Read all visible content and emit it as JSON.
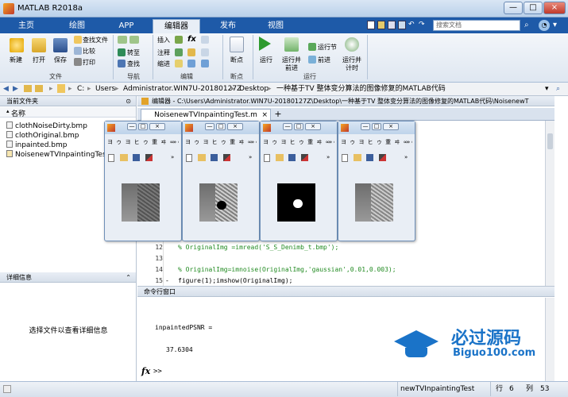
{
  "app": {
    "title": "MATLAB R2018a"
  },
  "window_controls": [
    "—",
    "□",
    "×"
  ],
  "tabs": [
    {
      "label": "主页"
    },
    {
      "label": "绘图"
    },
    {
      "label": "APP"
    },
    {
      "label": "编辑器"
    },
    {
      "label": "发布"
    },
    {
      "label": "视图"
    }
  ],
  "search": {
    "placeholder": "搜索文档"
  },
  "ribbon": {
    "file": {
      "new": "新建",
      "open": "打开",
      "save": "保存",
      "find_files": "查找文件",
      "compare": "比较",
      "print": "打印",
      "group": "文件"
    },
    "nav": {
      "goto": "转至",
      "find": "查找",
      "group": "导航"
    },
    "edit": {
      "insert": "插入",
      "comment": "注释",
      "indent": "缩进",
      "fx": "fx",
      "group": "编辑"
    },
    "breakpoints": {
      "label": "断点",
      "group": "断点"
    },
    "run": {
      "run": "运行",
      "run_advance_1": "运行并",
      "run_advance_2": "前进",
      "run_section": "运行节",
      "advance": "前进",
      "run_time_1": "运行并",
      "run_time_2": "计时",
      "group": "运行"
    }
  },
  "path": [
    "C:",
    "Users",
    "Administrator.WIN7U-20180127Z",
    "Desktop",
    "一种基于TV 整体变分算法的图像修复的MATLAB代码"
  ],
  "current_folder": {
    "header": "当前文件夹",
    "column": "名称",
    "files": [
      "clothNoiseDirty.bmp",
      "clothOriginal.bmp",
      "inpainted.bmp",
      "NoisenewTVInpaintingTest"
    ]
  },
  "details": {
    "header": "详细信息",
    "hint": "选择文件以查看详细信息"
  },
  "editor": {
    "header": "编辑器 - C:\\Users\\Administrator.WIN7U-20180127Z\\Desktop\\一种基于TV 整体变分算法的图像修复的MATLAB代码\\NoisenewT",
    "tab": "NoisenewTVInpaintingTest.m",
    "add_tab": "+",
    "lines": [
      {
        "num": "12",
        "marker": "",
        "text": "% OriginalImg =imread('S_S_Denimb_t.bmp');",
        "comment": true
      },
      {
        "num": "13",
        "marker": "",
        "text": "",
        "comment": false
      },
      {
        "num": "14",
        "marker": "",
        "text": "% OriginalImg=imnoise(OriginalImg,'gaussian',0.01,0.003);",
        "comment": true
      },
      {
        "num": "15",
        "marker": "-",
        "text": "figure(1);imshow(OriginalImg);",
        "comment": false
      }
    ]
  },
  "command_window": {
    "header": "命令行窗口",
    "output": [
      "inpaintedPSNR =",
      "37.6304"
    ],
    "prompt_fx": "fx",
    "prompt": ">>"
  },
  "figures": [
    {
      "image": "cloth-noisy"
    },
    {
      "image": "cloth-noisy-blob"
    },
    {
      "image": "mask"
    },
    {
      "image": "cloth-inpainted"
    }
  ],
  "figure_toolbar": {
    "row1": "ヨ ゥ ヨ ヒ ゥ 重 ヰ ∞ ∞",
    "more": "»"
  },
  "status": {
    "script": "newTVInpaintingTest",
    "row_label": "行",
    "row": "6",
    "col_label": "列",
    "col": "53"
  },
  "watermark": {
    "brand": "必过源码",
    "url": "Biguo100.com"
  },
  "colors": {
    "tab_bar": "#1e5aa8",
    "accent": "#1a73c8",
    "comment": "#228b22"
  }
}
